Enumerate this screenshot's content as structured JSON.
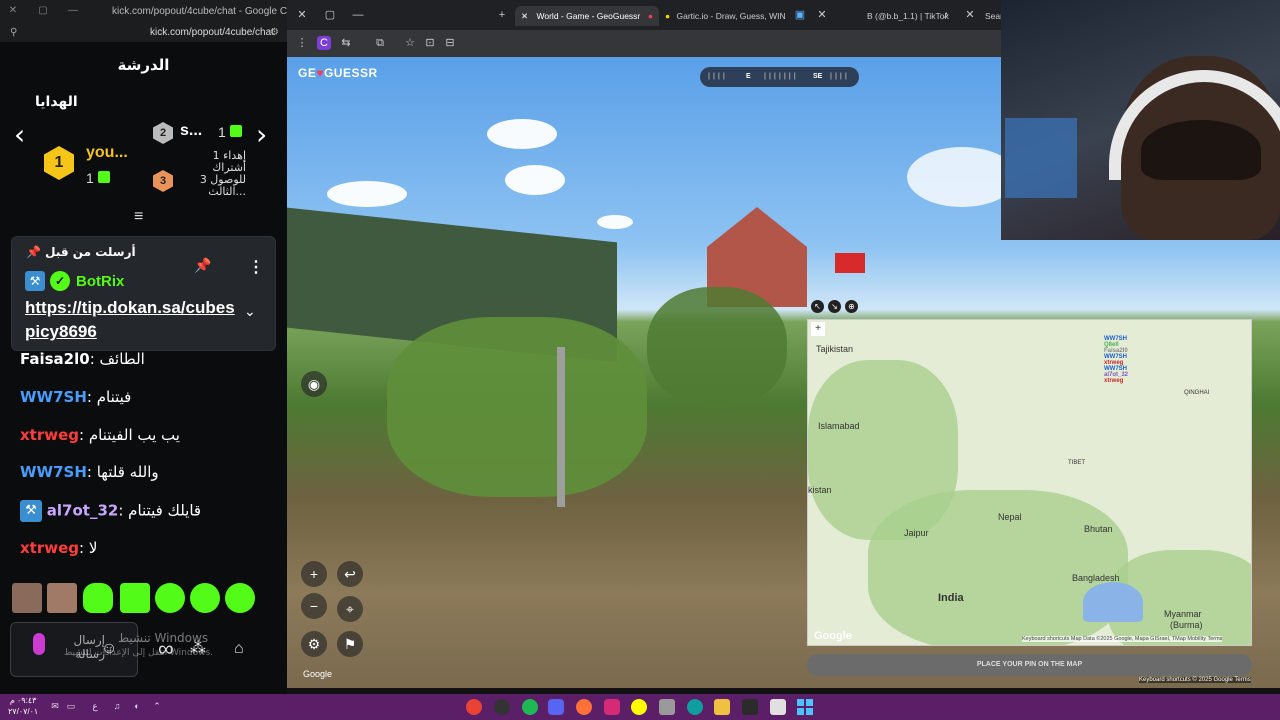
{
  "chat_window": {
    "title": "kick.com/popout/4cube/chat - Google Chrome",
    "url": "kick.com/popout/4cube/chat",
    "header": "الدرشة",
    "gifts_label": "الهدايا",
    "leader_1": {
      "rank": "1",
      "name": "you...",
      "count": "1"
    },
    "leader_2": {
      "rank": "2",
      "name": "s...",
      "count": "1"
    },
    "leader_3": {
      "rank": "3",
      "text": "إهداء 1 أشتراك للوصول 3 ...الثالث"
    },
    "pinned": {
      "label": "أرسلت من قبل",
      "user": "BotRix",
      "link": "https://tip.dokan.sa/cubespicy8696"
    },
    "messages": [
      {
        "user": "Faisa2l0",
        "text": "الطائف",
        "color": "#ffffff"
      },
      {
        "user": "WW7SH",
        "text": "فيتنام",
        "color": "#4a9cff"
      },
      {
        "user": "xtrweg",
        "text": "يب يب الفيتنام",
        "color": "#ff3d3d"
      },
      {
        "user": "WW7SH",
        "text": "والله قلتها",
        "color": "#4a9cff"
      },
      {
        "user": "al7ot_32",
        "text": "قايلك فيتنام",
        "color": "#c9a6ff"
      },
      {
        "user": "xtrweg",
        "text": "لا",
        "color": "#ff3d3d"
      }
    ],
    "input_placeholder": "إرسال رسالة",
    "watermark_1": "تنشيط Windows",
    "watermark_2": "انتقل إلى الإعدادات لتنشيط Windows."
  },
  "browser": {
    "tabs": [
      {
        "label": "World - Game - GeoGuessr"
      },
      {
        "label": "Gartic.io - Draw, Guess, WIN"
      },
      {
        "label": "B (@b.b_1.1) | TikTok"
      },
      {
        "label": "Sear"
      }
    ]
  },
  "game": {
    "logo_text_1": "GE",
    "logo_text_2": "GUESSR",
    "compass_e": "E",
    "compass_se": "SE",
    "google_watermark": "Google",
    "place_pin_label": "PLACE YOUR PIN ON THE MAP",
    "map": {
      "labels": [
        "Tajikistan",
        "Islamabad",
        "kistan",
        "Nepal",
        "Bhutan",
        "Jaipur",
        "India",
        "Bangladesh",
        "Myanmar",
        "(Burma)",
        "QINGHAI",
        "TIBET"
      ],
      "google": "Google",
      "footer": "Keyboard shortcuts   Map Data ©2025 Google, Mapa GISrael, TMap Mobility   Terms"
    },
    "guess_feed": [
      {
        "user": "WW7SH",
        "color": "#1a5fd0"
      },
      {
        "user": "Q8ell",
        "color": "#4caf50"
      },
      {
        "user": "Faisa2l0",
        "color": "#888888"
      },
      {
        "user": "WW7SH",
        "color": "#1a5fd0"
      },
      {
        "user": "xtrweg",
        "color": "#c62828"
      },
      {
        "user": "WW7SH",
        "color": "#1a5fd0"
      },
      {
        "user": "al7ot_32",
        "color": "#7e57c2"
      },
      {
        "user": "xtrweg",
        "color": "#c62828"
      }
    ],
    "bottom_right": "Keyboard shortcuts  © 2025 Google  Terms"
  },
  "taskbar": {
    "time": "٠٩:٤٣ م",
    "date": "٢٧/٠٧/٠١"
  }
}
